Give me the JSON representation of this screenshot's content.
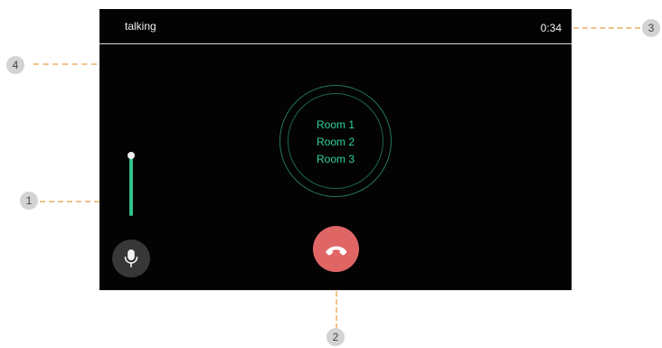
{
  "header": {
    "status": "talking",
    "timer": "0:34"
  },
  "rooms": [
    "Room 1",
    "Room 2",
    "Room 3"
  ],
  "volume": {
    "level": 1.0
  },
  "buttons": {
    "mic_icon": "microphone-icon",
    "end_call_icon": "phone-hangup-icon"
  },
  "callouts": [
    {
      "label": "1"
    },
    {
      "label": "2"
    },
    {
      "label": "3"
    },
    {
      "label": "4"
    }
  ],
  "colors": {
    "background": "#030303",
    "room_text": "#33d29d",
    "ring": "#22775f",
    "slider": "#32c089",
    "end_call": "#e06565",
    "mic_button": "#373737",
    "callout_line": "#f1c28a",
    "callout_badge": "#d3d3d3"
  }
}
